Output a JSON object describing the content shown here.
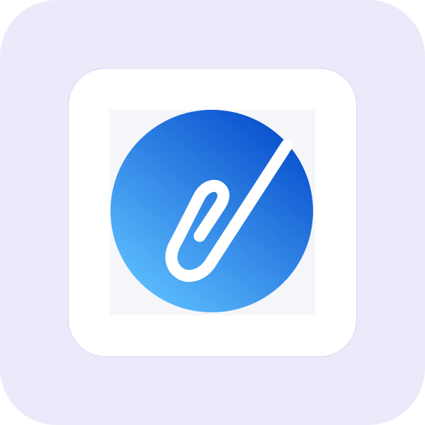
{
  "app_icon": {
    "name": "paperclip-icon",
    "colors": {
      "tile_background": "#ECE9FB",
      "card_background": "#FFFFFF",
      "frame_background": "#F5F6FA",
      "gradient_start": "#5ABAFC",
      "gradient_end": "#0B53CF",
      "glyph": "#FFFFFF"
    }
  }
}
